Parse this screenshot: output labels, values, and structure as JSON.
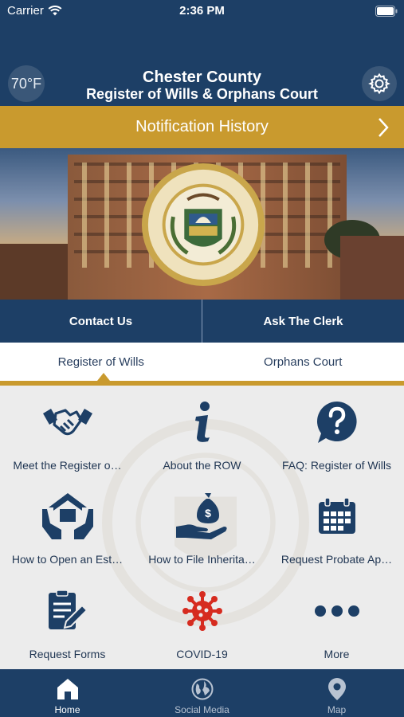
{
  "status": {
    "carrier": "Carrier",
    "time": "2:36 PM"
  },
  "header": {
    "temperature": "70°F",
    "title_line1": "Chester County",
    "title_line2": "Register of Wills & Orphans Court"
  },
  "notification": {
    "label": "Notification History"
  },
  "actions": {
    "contact": "Contact Us",
    "ask": "Ask The Clerk"
  },
  "tabs": [
    {
      "label": "Register of Wills",
      "selected": true
    },
    {
      "label": "Orphans Court",
      "selected": false
    }
  ],
  "grid": [
    {
      "label": "Meet the Register o…",
      "icon": "handshake-icon"
    },
    {
      "label": "About the ROW",
      "icon": "info-icon"
    },
    {
      "label": "FAQ: Register of Wills",
      "icon": "question-bubble-icon"
    },
    {
      "label": "How to Open an Est…",
      "icon": "house-hands-icon"
    },
    {
      "label": "How to File Inherita…",
      "icon": "money-bag-hand-icon"
    },
    {
      "label": "Request Probate Ap…",
      "icon": "calendar-icon"
    },
    {
      "label": "Request Forms",
      "icon": "form-pencil-icon"
    },
    {
      "label": "COVID-19",
      "icon": "virus-icon"
    },
    {
      "label": "More",
      "icon": "more-dots-icon"
    }
  ],
  "bottom_nav": [
    {
      "label": "Home",
      "icon": "home-icon",
      "active": true
    },
    {
      "label": "Social Media",
      "icon": "globe-icon",
      "active": false
    },
    {
      "label": "Map",
      "icon": "map-pin-icon",
      "active": false
    }
  ],
  "colors": {
    "navy": "#1d3f66",
    "gold": "#c99a2e",
    "virus_red": "#d62b1f"
  }
}
